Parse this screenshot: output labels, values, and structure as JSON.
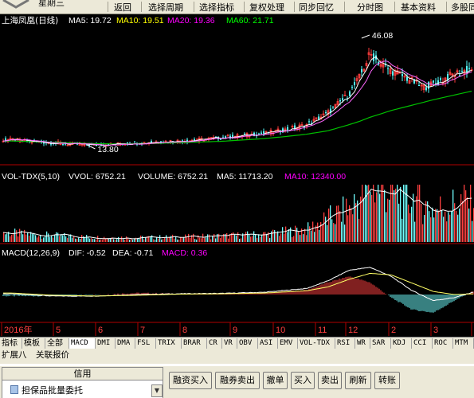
{
  "header": {
    "weekday": "星期三",
    "menu": [
      "返回",
      "选择周期",
      "选择指标",
      "复权处理",
      "同步回忆",
      "分时图",
      "基本资料",
      "多股同列"
    ]
  },
  "chart_data": [
    {
      "type": "candlestick",
      "title": "上海凤凰(日线)",
      "legend": [
        {
          "label": "MA5: 19.72",
          "color": "#ffffff"
        },
        {
          "label": "MA10: 19.51",
          "color": "#ffff00"
        },
        {
          "label": "MA20: 19.36",
          "color": "#ff00ff"
        },
        {
          "label": "MA60: 21.71",
          "color": "#00ff00"
        }
      ],
      "annotations": [
        {
          "label": "46.08",
          "type": "high",
          "x_month": 12.3,
          "value": 46.08
        },
        {
          "label": "13.80",
          "type": "low",
          "x_month": 5.8,
          "value": 13.8
        }
      ],
      "x_months": [
        4.0,
        4.5,
        5.0,
        5.5,
        6.0,
        6.5,
        7.0,
        7.5,
        8.0,
        8.5,
        9.0,
        9.5,
        10.0,
        10.5,
        11.0,
        11.5,
        12.0,
        12.25,
        12.5,
        12.75,
        13.0,
        13.25,
        13.5,
        13.75,
        14.0,
        14.5,
        15.0,
        15.5,
        16.0,
        16.5,
        17.0
      ],
      "close": [
        15.5,
        15.0,
        14.6,
        14.2,
        14.0,
        14.3,
        14.6,
        15.0,
        15.2,
        15.6,
        16.2,
        16.8,
        17.5,
        18.5,
        20.0,
        23.5,
        29.0,
        34.0,
        41.0,
        38.0,
        36.0,
        34.5,
        33.0,
        31.0,
        32.0,
        35.0,
        37.0,
        38.0,
        38.5,
        39.0,
        39.5
      ],
      "ma60": [
        15.2,
        15.0,
        14.8,
        14.6,
        14.4,
        14.3,
        14.4,
        14.5,
        14.7,
        14.9,
        15.1,
        15.5,
        15.9,
        16.5,
        17.2,
        18.2,
        20.0,
        21.0,
        22.2,
        23.2,
        24.2,
        25.0,
        25.8,
        26.6,
        27.4,
        28.8,
        30.2,
        31.6,
        32.8,
        33.6,
        34.2
      ]
    },
    {
      "type": "bar",
      "title": "VOL-TDX(5,10)",
      "legend": [
        {
          "label": "VVOL: 6752.21",
          "color": "#ffffff"
        },
        {
          "label": "VOLUME: 6752.21",
          "color": "#ffffff"
        },
        {
          "label": "MA5: 11713.20",
          "color": "#ffffff"
        },
        {
          "label": "MA10: 12340.00",
          "color": "#ff00ff"
        }
      ],
      "x_months": [
        4.0,
        5.0,
        6.0,
        7.0,
        8.0,
        9.0,
        10.0,
        11.0,
        11.5,
        12.0,
        12.5,
        13.0,
        13.5,
        14.0,
        14.5,
        15.0,
        16.0,
        17.0
      ],
      "volume": [
        2500,
        1800,
        1300,
        1200,
        1400,
        1700,
        2200,
        3500,
        6500,
        9000,
        16000,
        14000,
        12000,
        9000,
        10500,
        12500,
        11000,
        12000
      ]
    },
    {
      "type": "line",
      "title": "MACD(12,26,9)",
      "legend": [
        {
          "label": "DIF: -0.52",
          "color": "#ffffff"
        },
        {
          "label": "DEA: -0.71",
          "color": "#ffffff"
        },
        {
          "label": "MACD: 0.36",
          "color": "#ff00ff"
        }
      ],
      "x_months": [
        4.0,
        5.0,
        6.0,
        7.0,
        8.0,
        9.0,
        10.0,
        11.0,
        11.5,
        12.0,
        12.5,
        13.0,
        13.5,
        14.0,
        14.5,
        15.0,
        16.0,
        17.0
      ],
      "dif": [
        0.1,
        -0.2,
        -0.2,
        0.0,
        0.1,
        0.15,
        0.3,
        0.8,
        1.8,
        3.2,
        3.6,
        2.4,
        0.5,
        -0.8,
        -0.4,
        0.4,
        0.6,
        0.3
      ],
      "dea": [
        0.2,
        -0.1,
        -0.2,
        -0.1,
        0.05,
        0.1,
        0.2,
        0.5,
        1.0,
        2.0,
        2.8,
        2.6,
        1.5,
        0.4,
        0.0,
        0.1,
        0.4,
        0.4
      ]
    }
  ],
  "time_axis": {
    "labels": [
      "2016年",
      "5",
      "6",
      "7",
      "8",
      "9",
      "10",
      "11",
      "12",
      "2",
      "3",
      "4"
    ]
  },
  "tabs": [
    "指标",
    "模板",
    "全部",
    "MACD",
    "DMI",
    "DMA",
    "FSL",
    "TRIX",
    "BRAR",
    "CR",
    "VR",
    "OBV",
    "ASI",
    "EMV",
    "VOL-TDX",
    "RSI",
    "WR",
    "SAR",
    "KDJ",
    "CCI",
    "ROC",
    "MTM"
  ],
  "subtabs": [
    "扩展八",
    "关联报价"
  ],
  "credit_panel": {
    "title": "信用",
    "item": "担保品批量委托"
  },
  "trade_buttons": [
    "融资买入",
    "融券卖出",
    "撤单",
    "买入",
    "卖出",
    "刷新",
    "转账"
  ]
}
